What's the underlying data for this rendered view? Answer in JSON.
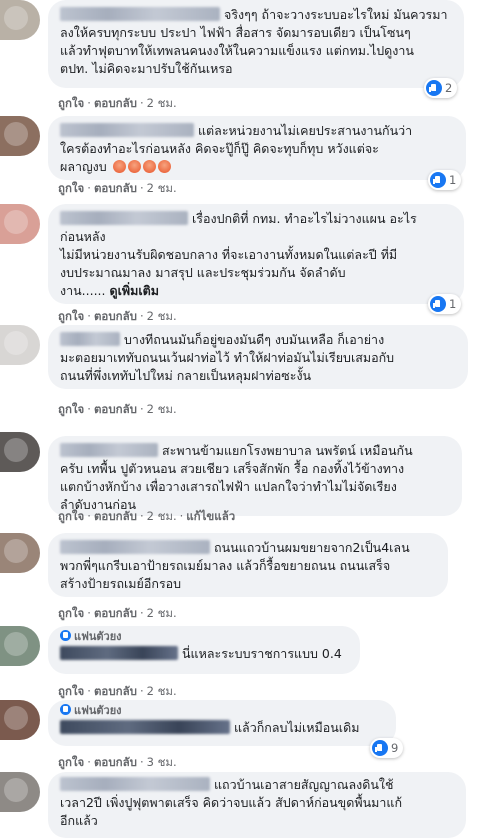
{
  "comments": [
    {
      "text": "จริงๆๆ ถ้าจะวางระบบอะไรใหม่ มันควรมาลงให้ครบทุกระบบ ประปา ไฟฟ้า สื่อสาร จัดมารอบเดียว เป็นโซนๆ แล้วทำฟุตบาทให้เทพลงนงนงให้ในความแข็งแรง แต่กทม.ไปดูงาน ตปท. ไม่คิดจะมาปรับใช้กันเหรอ",
      "lines": [
        "จริงๆๆ ถ้าจะวางระบบอะไรใหม่ มันควรมา",
        "ลงให้ครบทุกระบบ ประปา ไฟฟ้า สื่อสาร จัดมารอบเดียว เป็นโซนๆ",
        "แล้วทำฟุตบาทให้เทพลนคนงงให้ในความแข็งแรง แต่กทม.ไปดูงาน",
        "ตปท. ไม่คิดจะมาปรับใช้กันเหรอ"
      ],
      "like": "ถูกใจ",
      "reply": "ตอบกลับ",
      "time": "2 ชม.",
      "reactions": "2"
    },
    {
      "lines": [
        "แต่ละหน่วยงานไม่เคยประสานงานกันว่า",
        "ใครต้องทำอะไรก่อนหลัง คิดจะปู๊ก็ปู๊ คิดจะทุบก็ทุบ หวังแต่จะ",
        "ผลาญงบ"
      ],
      "like": "ถูกใจ",
      "reply": "ตอบกลับ",
      "time": "2 ชม.",
      "reactions": "1"
    },
    {
      "lines": [
        "เรื่องปกติที่ กทม. ทำอะไรไม่วางแผน อะไร",
        "ก่อนหลัง",
        "ไม่มีหน่วยงานรับผิดชอบกลาง ที่จะเอางานทั้งหมดในแต่ละปี ที่มี",
        "งบประมาณมาลง มาสรุป และประชุมร่วมกัน จัดลำดับ",
        "งาน......"
      ],
      "see_more": "ดูเพิ่มเติม",
      "like": "ถูกใจ",
      "reply": "ตอบกลับ",
      "time": "2 ชม.",
      "reactions": "1"
    },
    {
      "lines": [
        "บางทีถนนมันก็อยู่ของมันดีๆ งบมันเหลือ ก็เอาย่าง",
        "มะตอยมาเททับถนนเว้นฝาท่อไว้ ทำให้ฝาท่อมันไม่เรียบเสมอกับ",
        "ถนนที่พึ่งเททับไปใหม่ กลายเป็นหลุมฝาท่อซะงั้น"
      ],
      "like": "ถูกใจ",
      "reply": "ตอบกลับ",
      "time": "2 ชม."
    },
    {
      "lines": [
        "สะพานข้ามแยกโรงพยาบาล นพรัตน์ เหมือนกัน",
        "ครับ เทพื้น ปูตัวหนอน สวยเชียว เสร็จสักพัก รื้อ กองทิ้งไว้ข้างทาง",
        "แตกบ้างหักบ้าง เพื่อวางเสารถไฟฟ้า แปลกใจว่าทำไมไม่จัดเรียง",
        "ลำดับงานก่อน"
      ],
      "like": "ถูกใจ",
      "reply": "ตอบกลับ",
      "time": "2 ชม.",
      "edited": "แก้ไขแล้ว"
    },
    {
      "lines": [
        "ถนนแถวบ้านผมขยายจาก2เป็น4เลน",
        "พวกพี่ๆแกรีบเอาป้ายรถเมย์มาลง แล้วก็รื้อขยายถนน ถนนเสร็จ",
        "สร้างป้ายรถเมย์อีกรอบ"
      ],
      "like": "ถูกใจ",
      "reply": "ตอบกลับ",
      "time": "2 ชม."
    },
    {
      "badge": "แฟนตัวยง",
      "lines": [
        "นี่แหละระบบราชการแบบ 0.4"
      ],
      "like": "ถูกใจ",
      "reply": "ตอบกลับ",
      "time": "2 ชม."
    },
    {
      "badge": "แฟนตัวยง",
      "lines": [
        "แล้วก็กลบไม่เหมือนเดิม"
      ],
      "like": "ถูกใจ",
      "reply": "ตอบกลับ",
      "time": "3 ชม.",
      "reactions": "9"
    },
    {
      "lines": [
        "แถวบ้านเอาสายสัญญาณลงดินใช้",
        "เวลา2ปี เพิ่งปูฟุตพาตเสร็จ คิดว่าจบแล้ว สัปดาห์ก่อนขุดพื้นมาแก้",
        "อีกแล้ว"
      ]
    }
  ],
  "colors": {
    "bubble": "#f0f2f5",
    "like_blue": "#1877f2",
    "meta_gray": "#65676b"
  },
  "icons": {
    "reaction": "like-icon",
    "angry_emoji": "angry-face-icon",
    "fan_badge": "fan-badge-icon"
  }
}
